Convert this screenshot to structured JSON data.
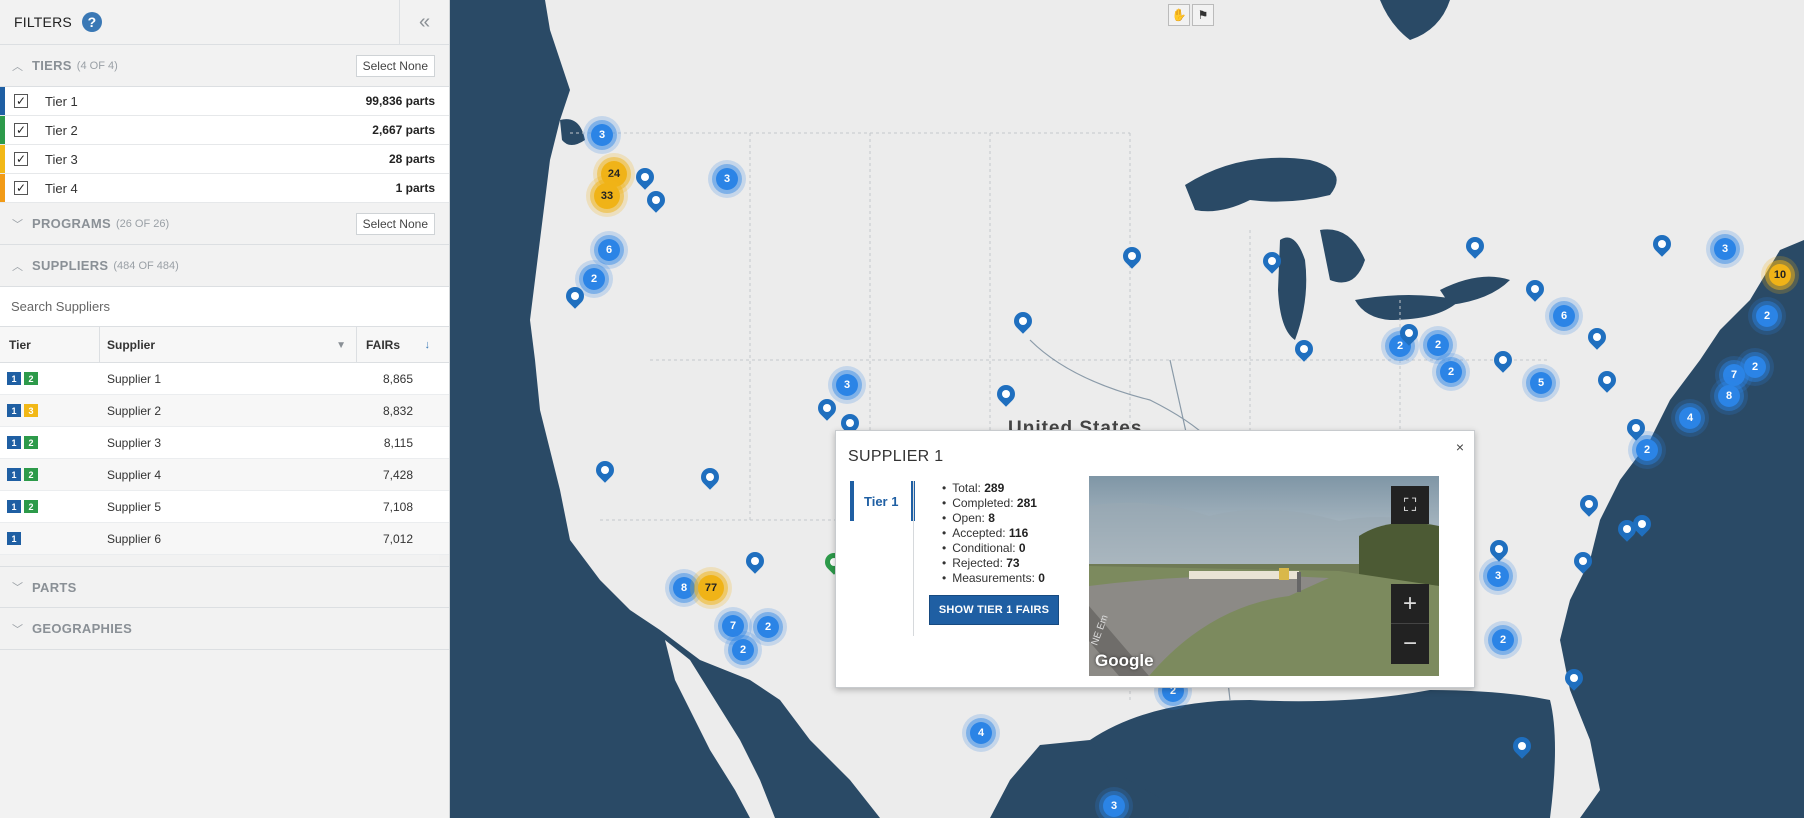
{
  "sidebar": {
    "title": "FILTERS",
    "help_icon": "?",
    "collapse_icon": "«",
    "tiers": {
      "label": "TIERS",
      "count": "(4 OF 4)",
      "select_none": "Select None",
      "items": [
        {
          "label": "Tier 1",
          "parts": "99,836 parts",
          "color": "#1f5fa3",
          "checked": "✓"
        },
        {
          "label": "Tier 2",
          "parts": "2,667 parts",
          "color": "#2d9a4a",
          "checked": "✓"
        },
        {
          "label": "Tier 3",
          "parts": "28 parts",
          "color": "#f2b817",
          "checked": "✓"
        },
        {
          "label": "Tier 4",
          "parts": "1 parts",
          "color": "#f29b17",
          "checked": "✓"
        }
      ]
    },
    "programs": {
      "label": "PROGRAMS",
      "count": "(26 OF 26)",
      "select_none": "Select None"
    },
    "suppliers": {
      "label": "SUPPLIERS",
      "count": "(484 OF 484)",
      "search_placeholder": "Search Suppliers",
      "columns": {
        "tier": "Tier",
        "supplier": "Supplier",
        "fairs": "FAIRs"
      },
      "rows": [
        {
          "badges": [
            "1",
            "2"
          ],
          "name": "Supplier 1",
          "fairs": "8,865"
        },
        {
          "badges": [
            "1",
            "3"
          ],
          "name": "Supplier 2",
          "fairs": "8,832"
        },
        {
          "badges": [
            "1",
            "2"
          ],
          "name": "Supplier 3",
          "fairs": "8,115"
        },
        {
          "badges": [
            "1",
            "2"
          ],
          "name": "Supplier 4",
          "fairs": "7,428"
        },
        {
          "badges": [
            "1",
            "2"
          ],
          "name": "Supplier 5",
          "fairs": "7,108"
        },
        {
          "badges": [
            "1"
          ],
          "name": "Supplier 6",
          "fairs": "7,012"
        }
      ]
    },
    "parts": {
      "label": "PARTS"
    },
    "geographies": {
      "label": "GEOGRAPHIES"
    }
  },
  "map": {
    "country_label": "United States",
    "colors": {
      "water": "#2a4a66",
      "land": "#ececec",
      "cluster": "#2b84e6",
      "cluster_alt": "#f0b317",
      "pin": "#1f6fbf"
    },
    "clusters": [
      {
        "n": "3",
        "c": "blue"
      },
      {
        "n": "24",
        "c": "yellow"
      },
      {
        "n": "33",
        "c": "yellow"
      },
      {
        "n": "3",
        "c": "blue"
      },
      {
        "n": "6",
        "c": "blue"
      },
      {
        "n": "2",
        "c": "blue"
      },
      {
        "n": "3",
        "c": "blue"
      },
      {
        "n": "8",
        "c": "blue"
      },
      {
        "n": "77",
        "c": "yellow"
      },
      {
        "n": "7",
        "c": "blue"
      },
      {
        "n": "2",
        "c": "blue"
      },
      {
        "n": "2",
        "c": "blue"
      },
      {
        "n": "4",
        "c": "blue"
      },
      {
        "n": "3",
        "c": "blue"
      },
      {
        "n": "2",
        "c": "blue"
      },
      {
        "n": "2",
        "c": "blue"
      },
      {
        "n": "2",
        "c": "blue"
      },
      {
        "n": "6",
        "c": "blue"
      },
      {
        "n": "5",
        "c": "blue"
      },
      {
        "n": "3",
        "c": "blue"
      },
      {
        "n": "10",
        "c": "yellow"
      },
      {
        "n": "2",
        "c": "blue"
      },
      {
        "n": "7",
        "c": "blue"
      },
      {
        "n": "2",
        "c": "blue"
      },
      {
        "n": "8",
        "c": "blue"
      },
      {
        "n": "4",
        "c": "blue"
      },
      {
        "n": "2",
        "c": "blue"
      },
      {
        "n": "3",
        "c": "blue"
      },
      {
        "n": "2",
        "c": "blue"
      },
      {
        "n": "2",
        "c": "blue"
      }
    ]
  },
  "popup": {
    "title": "SUPPLIER 1",
    "close": "×",
    "tab": "Tier 1",
    "stats": [
      {
        "label": "Total:",
        "value": "289"
      },
      {
        "label": "Completed:",
        "value": "281"
      },
      {
        "label": "Open:",
        "value": "8"
      },
      {
        "label": "Accepted:",
        "value": "116"
      },
      {
        "label": "Conditional:",
        "value": "0"
      },
      {
        "label": "Rejected:",
        "value": "73"
      },
      {
        "label": "Measurements:",
        "value": "0"
      }
    ],
    "button": "SHOW TIER 1 FAIRS",
    "streetview": {
      "brand": "Google",
      "road_text": "NE Em",
      "zoom_in": "+",
      "zoom_out": "−",
      "fullscreen": "⛶"
    }
  }
}
